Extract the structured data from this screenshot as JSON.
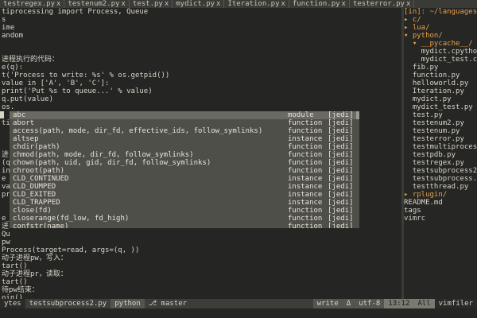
{
  "tabs": [
    {
      "label": "testregex.py",
      "close": "x",
      "active": false
    },
    {
      "label": "testenum2.py",
      "close": "x",
      "active": false
    },
    {
      "label": "test.py",
      "close": "x",
      "active": false
    },
    {
      "label": "mydict.py",
      "close": "x",
      "active": false
    },
    {
      "label": "Iteration.py",
      "close": "x",
      "active": false
    },
    {
      "label": "function.py",
      "close": "x",
      "active": false
    },
    {
      "label": "testerror.py",
      "close": "x",
      "active": false
    }
  ],
  "code_lines": [
    "tiprocessing import Process, Queue",
    "s",
    "ime",
    "andom",
    "",
    "",
    "进程执行的代码：",
    "e(q):",
    "t('Process to write: %s' % os.getpid())",
    "value in ['A', 'B', 'C']:",
    "print('Put %s to queue...' % value)",
    "q.put(value)",
    "os.",
    "ti",
    "",
    "",
    "",
    "进",
    "(q",
    "in",
    "e",
    "va",
    "pr",
    "",
    "",
    "e_",
    "进",
    "Qu",
    "pw",
    "Process(target=read, args=(q, ))",
    "动子进程pw，写入：",
    "tart()",
    "动子进程pr，读取：",
    "tart()",
    "待pw结束：",
    "oin()",
    "进程里是死循环，无法等待其结束，只能强行终止：",
    "erminate()"
  ],
  "completions": [
    {
      "name": "abc",
      "kind": "module",
      "source": "[jedi]",
      "selected": true
    },
    {
      "name": "abort",
      "kind": "function",
      "source": "[jedi]",
      "selected": false
    },
    {
      "name": "access(path, mode, dir_fd, effective_ids, follow_symlinks)",
      "kind": "function",
      "source": "[jedi]",
      "selected": false
    },
    {
      "name": "altsep",
      "kind": "instance",
      "source": "[jedi]",
      "selected": false
    },
    {
      "name": "chdir(path)",
      "kind": "function",
      "source": "[jedi]",
      "selected": false
    },
    {
      "name": "chmod(path, mode, dir_fd, follow_symlinks)",
      "kind": "function",
      "source": "[jedi]",
      "selected": false
    },
    {
      "name": "chown(path, uid, gid, dir_fd, follow_symlinks)",
      "kind": "function",
      "source": "[jedi]",
      "selected": false
    },
    {
      "name": "chroot(path)",
      "kind": "function",
      "source": "[jedi]",
      "selected": false
    },
    {
      "name": "CLD_CONTINUED",
      "kind": "instance",
      "source": "[jedi]",
      "selected": false
    },
    {
      "name": "CLD_DUMPED",
      "kind": "instance",
      "source": "[jedi]",
      "selected": false
    },
    {
      "name": "CLD_EXITED",
      "kind": "instance",
      "source": "[jedi]",
      "selected": false
    },
    {
      "name": "CLD_TRAPPED",
      "kind": "instance",
      "source": "[jedi]",
      "selected": false
    },
    {
      "name": "close(fd)",
      "kind": "function",
      "source": "[jedi]",
      "selected": false
    },
    {
      "name": "closerange(fd_low, fd_high)",
      "kind": "function",
      "source": "[jedi]",
      "selected": false
    },
    {
      "name": "confstr(name)",
      "kind": "function",
      "source": "[jedi]",
      "selected": false
    }
  ],
  "tree": {
    "root": "[in]: ~/languages/",
    "items": [
      {
        "label": "▸ c/",
        "type": "dir"
      },
      {
        "label": "▸ lua/",
        "type": "dir"
      },
      {
        "label": "▾ python/",
        "type": "dir"
      },
      {
        "label": "  ▾ __pycache__/",
        "type": "dir"
      },
      {
        "label": "    mydict.cpython-3",
        "type": "file"
      },
      {
        "label": "    mydict_test.cpyt",
        "type": "file"
      },
      {
        "label": "  fib.py",
        "type": "file"
      },
      {
        "label": "  function.py",
        "type": "file"
      },
      {
        "label": "  helloworld.py",
        "type": "file"
      },
      {
        "label": "  Iteration.py",
        "type": "file"
      },
      {
        "label": "  mydict.py",
        "type": "file"
      },
      {
        "label": "  mydict_test.py",
        "type": "file"
      },
      {
        "label": "  test.py",
        "type": "file"
      },
      {
        "label": "  testenum2.py",
        "type": "file"
      },
      {
        "label": "  testenum.py",
        "type": "file"
      },
      {
        "label": "  testerror.py",
        "type": "file"
      },
      {
        "label": "  testmultiprocess",
        "type": "file"
      },
      {
        "label": "  testpdb.py",
        "type": "file"
      },
      {
        "label": "  testregex.py",
        "type": "file"
      },
      {
        "label": "  testsubprocess2.p",
        "type": "file"
      },
      {
        "label": "  testsubprocess.py",
        "type": "file"
      },
      {
        "label": "  testthread.py",
        "type": "file"
      },
      {
        "label": "▸ rplugin/",
        "type": "dir"
      },
      {
        "label": "README.md",
        "type": "file"
      },
      {
        "label": "tags",
        "type": "file"
      },
      {
        "label": "vimrc",
        "type": "file"
      }
    ]
  },
  "status": {
    "size": "ytes",
    "filename": "testsubprocess2.py",
    "filetype": "python",
    "git_icon": "⎇",
    "branch": "master",
    "mode": "write",
    "delta": "Δ",
    "encoding": "utf-8",
    "position": "13:12",
    "scope": "All",
    "right_label": "vimfiler"
  }
}
